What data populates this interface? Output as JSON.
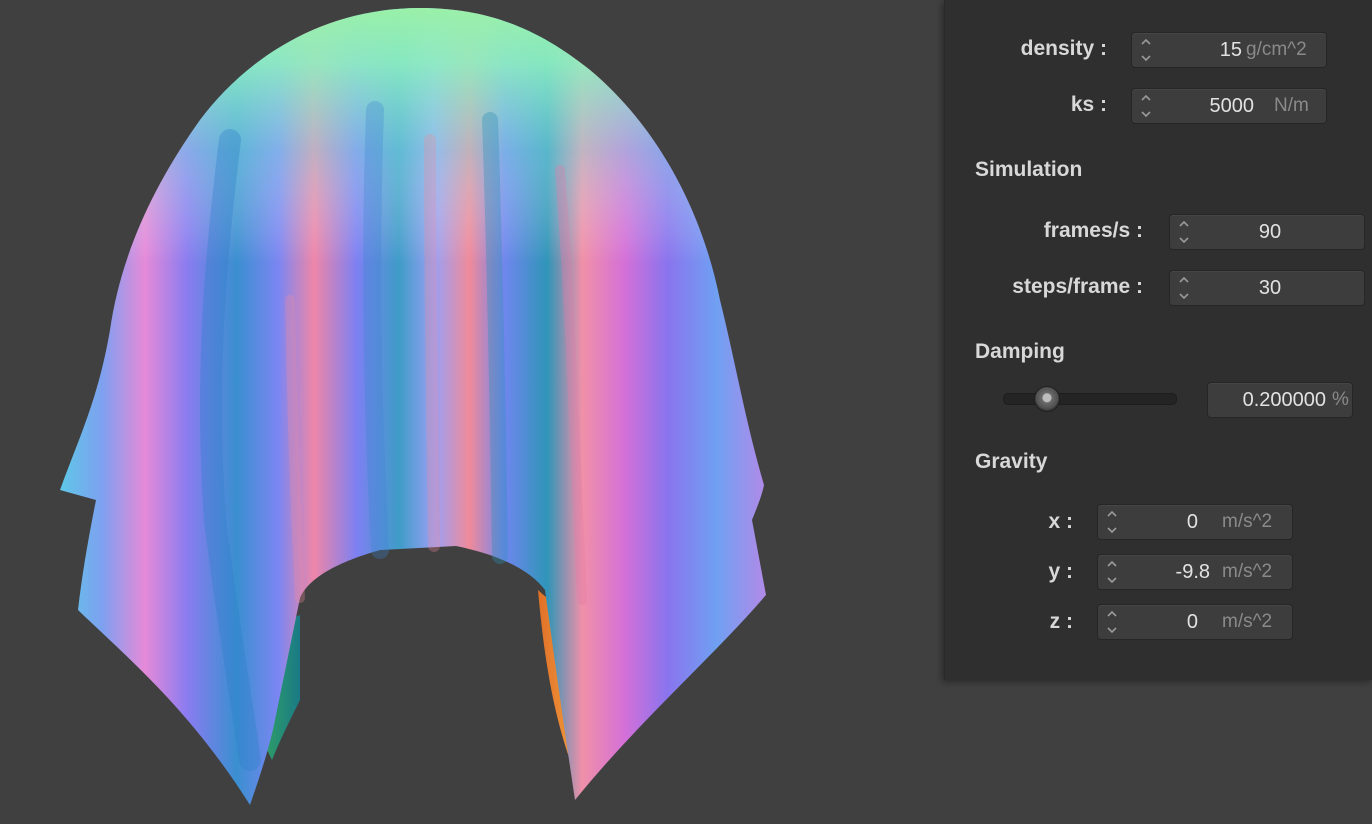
{
  "colors": {
    "background": "#404040",
    "panel": "#2f2f2f",
    "field": "#3d3d3d",
    "label": "#d8d8d8",
    "unit": "#8a8a8a"
  },
  "viewport": {
    "object": "cloth draped over sphere (normal-shaded mesh)"
  },
  "material": {
    "density": {
      "label": "density :",
      "value": "15",
      "unit": "g/cm^2"
    },
    "ks": {
      "label": "ks :",
      "value": "5000",
      "unit": "N/m"
    }
  },
  "simulation": {
    "title": "Simulation",
    "fps": {
      "label": "frames/s :",
      "value": "90"
    },
    "steps": {
      "label": "steps/frame :",
      "value": "30"
    }
  },
  "damping": {
    "title": "Damping",
    "value": "0.200000",
    "unit": "%",
    "slider_fraction": 0.2
  },
  "gravity": {
    "title": "Gravity",
    "x": {
      "label": "x :",
      "value": "0",
      "unit": "m/s^2"
    },
    "y": {
      "label": "y :",
      "value": "-9.8",
      "unit": "m/s^2"
    },
    "z": {
      "label": "z :",
      "value": "0",
      "unit": "m/s^2"
    }
  }
}
